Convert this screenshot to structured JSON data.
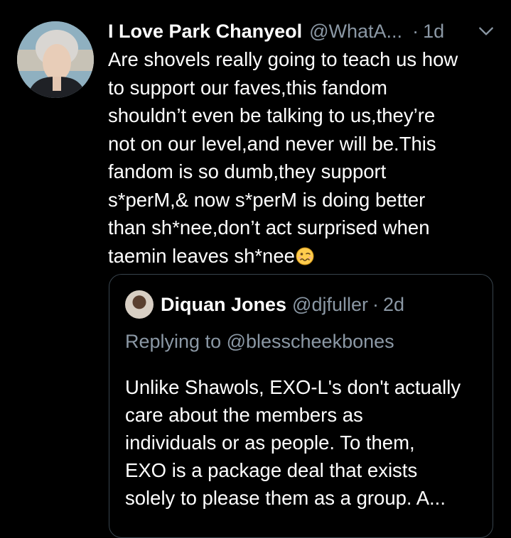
{
  "tweet": {
    "author_name": "I Love Park Chanyeol",
    "author_handle": "@WhatA...",
    "separator": "·",
    "time": "1d",
    "text": "Are shovels really going to teach us how\nto support our faves,this fandom\nshouldn’t even be talking to us,they’re\nnot on our level,and never will be.This\nfandom is so dumb,they support\ns*perM,& now s*perM is doing better\nthan sh*nee,don’t act surprised when\ntaemin leaves sh*nee",
    "emoji": "woozy-face-emoji"
  },
  "quoted_tweet": {
    "author_name": "Diquan Jones",
    "author_handle": "@djfuller",
    "separator": "·",
    "time": "2d",
    "replying_to": "Replying to @blesscheekbones",
    "text": "Unlike Shawols, EXO-L's don't actually\ncare about the members as\nindividuals or as people. To them,\nEXO is a package deal that exists\nsolely to please them as a group. A..."
  },
  "colors": {
    "background": "#000000",
    "primary_text": "#ffffff",
    "secondary_text": "#8b98a5",
    "quote_border": "#38444d"
  }
}
